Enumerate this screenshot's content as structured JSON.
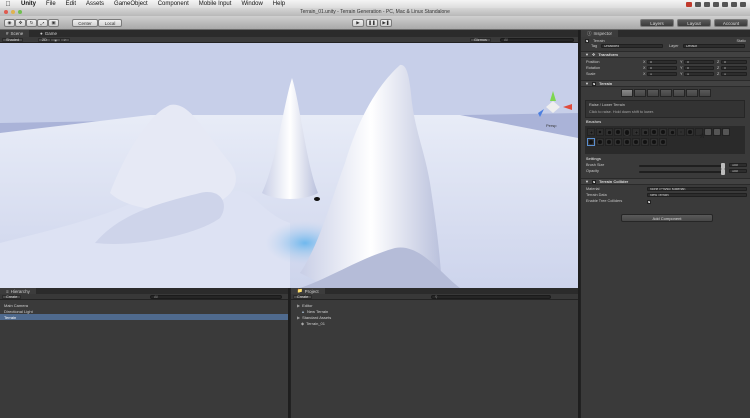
{
  "menubar": {
    "items": [
      "Unity",
      "File",
      "Edit",
      "Assets",
      "GameObject",
      "Component",
      "Mobile Input",
      "Window",
      "Help"
    ]
  },
  "window": {
    "title": "Terrain_01.unity - Terrain Generation - PC, Mac & Linux Standalone"
  },
  "toolbar": {
    "pivot_label": "Center",
    "space_label": "Local",
    "layers_label": "Layers",
    "layout_label": "Layout",
    "account_label": "Account"
  },
  "scene": {
    "tab_scene": "Scene",
    "tab_game": "Game",
    "shaded_label": "Shaded",
    "mode_2d": "2D",
    "gizmos_label": "Gizmos",
    "search_placeholder": "All",
    "persp_label": "Persp"
  },
  "hierarchy": {
    "tab": "Hierarchy",
    "create_label": "Create",
    "search_placeholder": "All",
    "items": [
      "Main Camera",
      "Directional Light",
      "Terrain"
    ],
    "selected_index": 2
  },
  "project": {
    "tab": "Project",
    "create_label": "Create",
    "items": [
      "Editor",
      "New Terrain",
      "Standard Assets",
      "Terrain_01"
    ]
  },
  "inspector": {
    "tab": "Inspector",
    "object_name": "Terrain",
    "static_label": "Static",
    "tag_label": "Tag",
    "tag_value": "Untagged",
    "layer_label": "Layer",
    "layer_value": "Default",
    "transform": {
      "title": "Transform",
      "rows": [
        {
          "label": "Position",
          "x": "0",
          "y": "0",
          "z": "0"
        },
        {
          "label": "Rotation",
          "x": "0",
          "y": "0",
          "z": "0"
        },
        {
          "label": "Scale",
          "x": "1",
          "y": "1",
          "z": "1"
        }
      ]
    },
    "terrain": {
      "title": "Terrain",
      "tool_title": "Raise / Lower Terrain",
      "tool_hint": "Click to raise. Hold down shift to lower.",
      "brushes_label": "Brushes",
      "settings_label": "Settings",
      "brush_size_label": "Brush Size",
      "brush_size_value": "100",
      "brush_size_fraction": 0.95,
      "opacity_label": "Opacity",
      "opacity_value": "100",
      "opacity_fraction": 0.95
    },
    "collider": {
      "title": "Terrain Collider",
      "material_label": "Material",
      "material_value": "None (Physic Material)",
      "data_label": "Terrain Data",
      "data_value": "New Terrain",
      "trees_label": "Enable Tree Colliders"
    },
    "add_component_label": "Add Component"
  },
  "colors": {
    "selection": "#4f6a8e",
    "panel": "#3a3a3a",
    "toolbar": "#bdbdbd"
  }
}
